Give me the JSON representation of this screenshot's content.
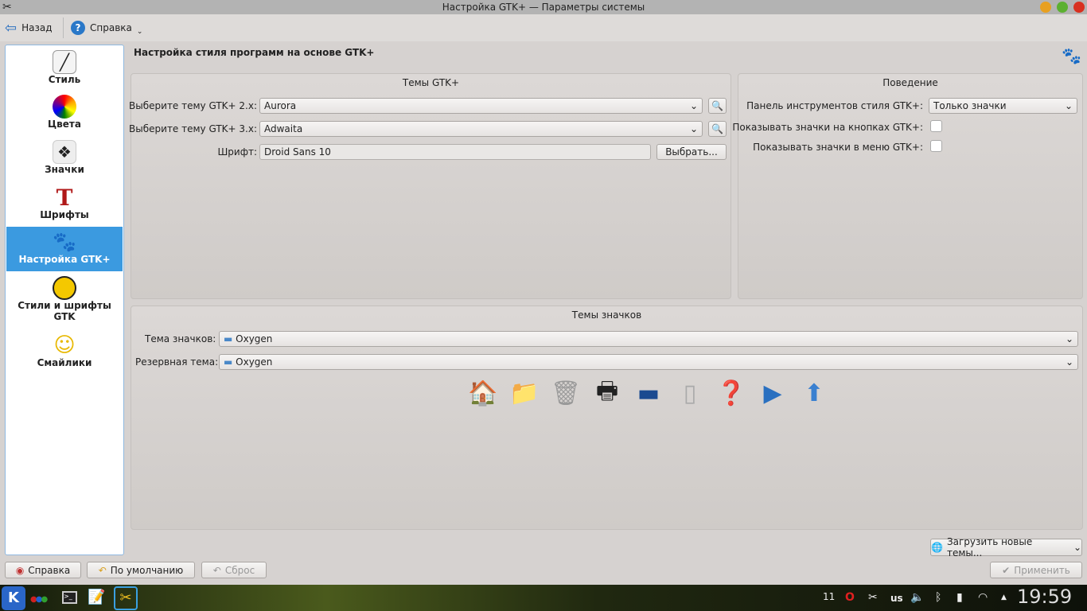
{
  "window": {
    "title": "Настройка GTK+ — Параметры системы"
  },
  "toolbar": {
    "back": "Назад",
    "help": "Справка"
  },
  "sidebar": {
    "items": [
      {
        "label": "Стиль",
        "icon": "style-icon"
      },
      {
        "label": "Цвета",
        "icon": "colors-icon"
      },
      {
        "label": "Значки",
        "icon": "icons-icon"
      },
      {
        "label": "Шрифты",
        "icon": "fonts-icon"
      },
      {
        "label": "Настройка GTK+",
        "icon": "gtk-icon",
        "selected": true
      },
      {
        "label": "Стили и шрифты GTK",
        "icon": "gtk-styles-icon"
      },
      {
        "label": "Смайлики",
        "icon": "smiley-icon"
      }
    ]
  },
  "main": {
    "title": "Настройка стиля программ на основе GTK+",
    "gtk_themes": {
      "title": "Темы GTK+",
      "gtk2_label": "Выберите тему GTK+ 2.x:",
      "gtk2_value": "Aurora",
      "gtk3_label": "Выберите тему GTK+ 3.x:",
      "gtk3_value": "Adwaita",
      "font_label": "Шрифт:",
      "font_value": "Droid Sans 10",
      "choose": "Выбрать..."
    },
    "behavior": {
      "title": "Поведение",
      "toolbar_label": "Панель инструментов стиля GTK+:",
      "toolbar_value": "Только значки",
      "buttons_label": "Показывать значки на кнопках GTK+:",
      "menu_label": "Показывать значки в меню GTK+:",
      "buttons_checked": false,
      "menu_checked": false
    },
    "icon_themes": {
      "title": "Темы значков",
      "theme_label": "Тема значков:",
      "theme_value": "Oxygen",
      "fallback_label": "Резервная тема:",
      "fallback_value": "Oxygen"
    },
    "download": "Загрузить новые темы..."
  },
  "footer": {
    "help": "Справка",
    "defaults": "По умолчанию",
    "reset": "Сброс",
    "apply": "Применить"
  },
  "tray": {
    "updates": "11",
    "layout": "us",
    "clock": "19:59"
  }
}
